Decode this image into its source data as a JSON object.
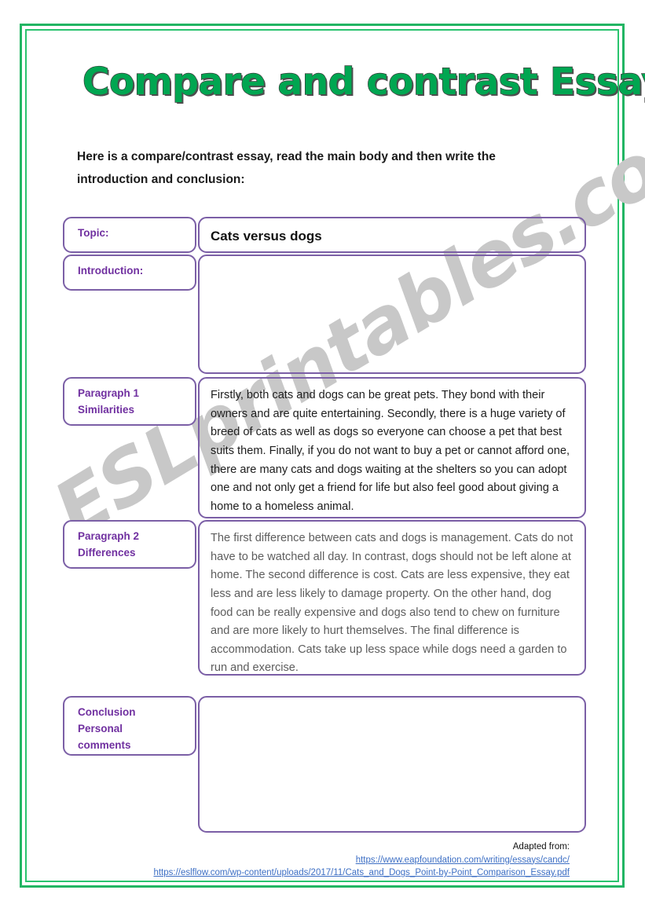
{
  "page": {
    "title": "Compare and contrast Essay",
    "instruction": "Here is a compare/contrast essay, read the main body and then write the introduction and conclusion:",
    "watermark": "ESLprintables.com",
    "frame_color": "#22b563",
    "title_color": "#00a651",
    "accent_color": "#7b5fa6",
    "label_color": "#7030a0",
    "link_color": "#3d6fc4"
  },
  "table": {
    "rows": [
      {
        "label": "Topic:",
        "value": "Cats versus dogs",
        "filled": true
      },
      {
        "label": "Introduction:",
        "value": "",
        "filled": false
      },
      {
        "label": "Paragraph 1\nSimilarities",
        "label_line1": "Paragraph 1",
        "label_line2": "Similarities",
        "value": "Firstly, both cats and dogs can be great pets. They bond with their owners and are quite entertaining. Secondly, there is a huge variety of breed of cats as well as dogs so everyone can choose a pet that best suits them. Finally, if you do not want to buy a pet or cannot afford one, there are many cats and dogs waiting at the shelters so you can adopt one and not only get a friend for life but also feel good about giving a home to a homeless animal.",
        "filled": true
      },
      {
        "label": "Paragraph 2\nDifferences",
        "label_line1": "Paragraph 2",
        "label_line2": "Differences",
        "value": "The first difference between cats and dogs is management. Cats do not have to be watched all day. In contrast, dogs should not be left alone at home. The second difference is cost. Cats are less expensive, they eat less and are less likely to damage property. On the other hand, dog food can be really expensive and dogs also tend to chew on furniture and are more likely to hurt themselves. The final difference is accommodation. Cats take up less space while dogs need a garden to run and exercise.",
        "filled": true
      },
      {
        "label_line1": "Conclusion",
        "label_line2": "Personal",
        "label_line3": "comments",
        "value": "",
        "filled": false
      }
    ]
  },
  "footer": {
    "adapted_label": "Adapted from:",
    "link_1": "https://www.eapfoundation.com/writing/essays/candc/",
    "link_2": "https://eslflow.com/wp-content/uploads/2017/11/Cats_and_Dogs_Point-by-Point_Comparison_Essay.pdf"
  }
}
